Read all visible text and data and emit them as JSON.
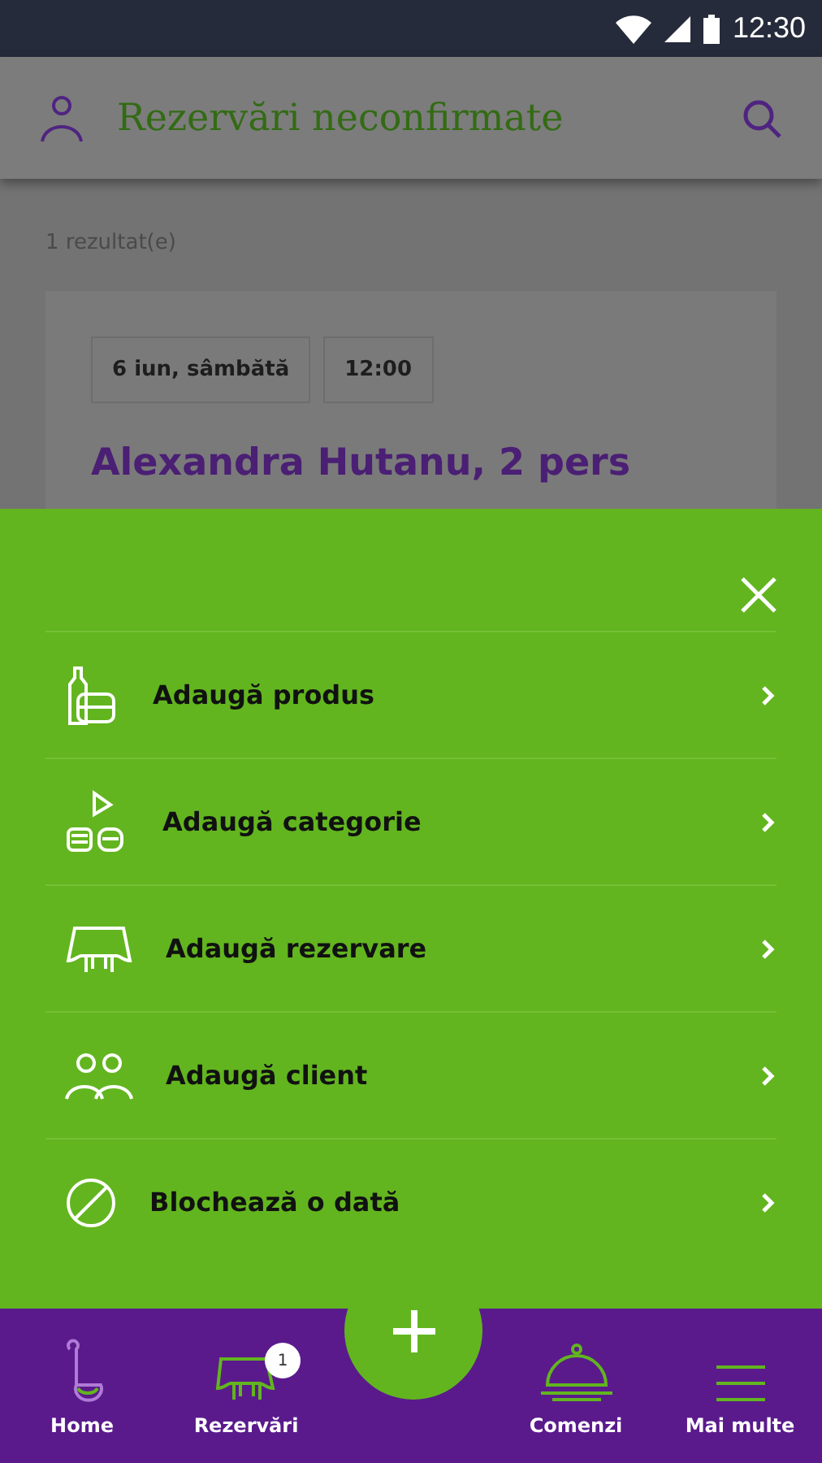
{
  "status_bar": {
    "time": "12:30"
  },
  "app_bar": {
    "title": "Rezervări neconfirmate"
  },
  "results": {
    "count": "1 rezultat(e)"
  },
  "reservation": {
    "date": "6 iun, sâmbătă",
    "time": "12:00",
    "name": "Alexandra Hutanu, 2 pers"
  },
  "menu_items": [
    {
      "kind": "product",
      "label": "Adaugă produs"
    },
    {
      "kind": "category",
      "label": "Adaugă categorie"
    },
    {
      "kind": "reservation",
      "label": "Adaugă rezervare"
    },
    {
      "kind": "client",
      "label": "Adaugă client"
    },
    {
      "kind": "block",
      "label": "Blochează o dată"
    }
  ],
  "bottom_nav": [
    {
      "kind": "home",
      "label": "Home",
      "selected": true
    },
    {
      "kind": "reservations",
      "label": "Rezervări",
      "selected": false,
      "badge": "1"
    },
    {
      "kind": "orders",
      "label": "Comenzi",
      "selected": false
    },
    {
      "kind": "more",
      "label": "Mai multe",
      "selected": false
    }
  ]
}
